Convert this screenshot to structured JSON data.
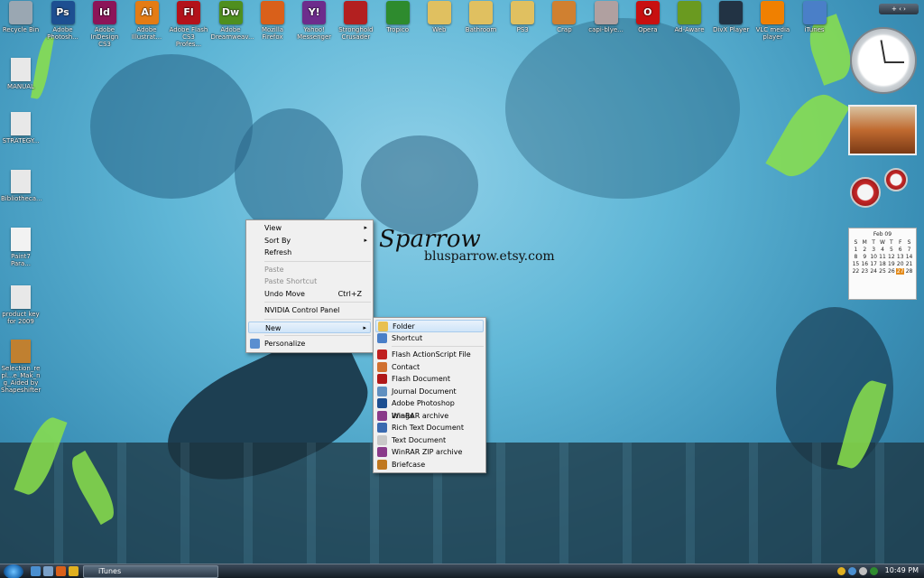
{
  "desktop_icons_top": [
    {
      "label": "Recycle Bin",
      "glyph": "",
      "color": "#9aa7b2",
      "icon": "recycle-bin-icon"
    },
    {
      "label": "Adobe Photosh...",
      "glyph": "Ps",
      "color": "#1d4f91",
      "icon": "photoshop-icon"
    },
    {
      "label": "Adobe InDesign CS3",
      "glyph": "Id",
      "color": "#8c1458",
      "icon": "indesign-icon"
    },
    {
      "label": "Adobe Illustrat...",
      "glyph": "Ai",
      "color": "#e47c14",
      "icon": "illustrator-icon"
    },
    {
      "label": "Adobe Flash CS3 Profes...",
      "glyph": "Fl",
      "color": "#b3121a",
      "icon": "flash-icon"
    },
    {
      "label": "Adobe Dreamweav...",
      "glyph": "Dw",
      "color": "#4f8f1f",
      "icon": "dreamweaver-icon"
    },
    {
      "label": "Mozilla Firefox",
      "glyph": "",
      "color": "#d9601a",
      "icon": "firefox-icon"
    },
    {
      "label": "Yahoo! Messenger",
      "glyph": "Y!",
      "color": "#6d2c8c",
      "icon": "yahoo-messenger-icon"
    },
    {
      "label": "Stronghold Crusader",
      "glyph": "",
      "color": "#b32020",
      "icon": "stronghold-icon"
    },
    {
      "label": "Tropico",
      "glyph": "",
      "color": "#2e8b2e",
      "icon": "tropico-icon"
    },
    {
      "label": "Web",
      "glyph": "",
      "color": "#e0c060",
      "icon": "folder-icon"
    },
    {
      "label": "Bathroom",
      "glyph": "",
      "color": "#e0c060",
      "icon": "folder-icon"
    },
    {
      "label": "PS3",
      "glyph": "",
      "color": "#e0c060",
      "icon": "folder-icon"
    },
    {
      "label": "Crap",
      "glyph": "",
      "color": "#d08030",
      "icon": "folder-icon"
    },
    {
      "label": "capi-blye...",
      "glyph": "",
      "color": "#b0a0a0",
      "icon": "image-file-icon"
    },
    {
      "label": "Opera",
      "glyph": "O",
      "color": "#c81010",
      "icon": "opera-icon"
    },
    {
      "label": "Ad-Aware",
      "glyph": "",
      "color": "#6a9a20",
      "icon": "ad-aware-icon"
    },
    {
      "label": "DivX Player",
      "glyph": "",
      "color": "#223344",
      "icon": "divx-icon"
    },
    {
      "label": "VLC media player",
      "glyph": "",
      "color": "#f08000",
      "icon": "vlc-icon"
    },
    {
      "label": "iTunes",
      "glyph": "",
      "color": "#4a7fc8",
      "icon": "itunes-icon"
    }
  ],
  "desktop_icons_left": [
    {
      "label": "MANUAL",
      "icon": "document-icon"
    },
    {
      "label": "STRATEGY...",
      "icon": "document-icon"
    },
    {
      "label": "Bibliotheca...",
      "icon": "document-icon"
    },
    {
      "label": "Paint7 Para...",
      "icon": "pdf-icon"
    },
    {
      "label": "product key for 2009",
      "icon": "text-file-icon"
    },
    {
      "label": "Selection_re pl...e_Mak_n g_Aided by Shapeshifter",
      "icon": "shortcut-icon"
    }
  ],
  "wallpaper": {
    "title": "Sparrow",
    "url": "blusparrow.etsy.com"
  },
  "context_menu": [
    {
      "label": "View",
      "submenu": true
    },
    {
      "label": "Sort By",
      "submenu": true
    },
    {
      "label": "Refresh"
    },
    {
      "sep": true
    },
    {
      "label": "Paste",
      "disabled": true
    },
    {
      "label": "Paste Shortcut",
      "disabled": true
    },
    {
      "label": "Undo Move",
      "shortcut": "Ctrl+Z"
    },
    {
      "sep": true
    },
    {
      "label": "NVIDIA Control Panel"
    },
    {
      "sep": true
    },
    {
      "label": "New",
      "submenu": true,
      "highlighted": true
    },
    {
      "sep": true
    },
    {
      "label": "Personalize",
      "icon": "personalize-icon"
    }
  ],
  "new_submenu": [
    {
      "label": "Folder",
      "icon": "folder-icon",
      "color": "#e8c050",
      "highlighted": true
    },
    {
      "label": "Shortcut",
      "icon": "shortcut-icon",
      "color": "#4a7fc8"
    },
    {
      "sep": true
    },
    {
      "label": "Flash ActionScript File",
      "icon": "flash-as-icon",
      "color": "#c02020"
    },
    {
      "label": "Contact",
      "icon": "contact-icon",
      "color": "#d07030"
    },
    {
      "label": "Flash Document",
      "icon": "flash-doc-icon",
      "color": "#b01818"
    },
    {
      "label": "Journal Document",
      "icon": "journal-icon",
      "color": "#6090c0"
    },
    {
      "label": "Adobe Photoshop Image",
      "icon": "photoshop-image-icon",
      "color": "#1d4f91"
    },
    {
      "label": "WinRAR archive",
      "icon": "winrar-icon",
      "color": "#8a3a8a"
    },
    {
      "label": "Rich Text Document",
      "icon": "rtf-icon",
      "color": "#3a6ab0"
    },
    {
      "label": "Text Document",
      "icon": "text-doc-icon",
      "color": "#c8c8c8"
    },
    {
      "label": "WinRAR ZIP archive",
      "icon": "winrar-zip-icon",
      "color": "#8a3a8a"
    },
    {
      "label": "Briefcase",
      "icon": "briefcase-icon",
      "color": "#c07820"
    }
  ],
  "calendar": {
    "month": "Feb 09",
    "weekdays": [
      "S",
      "M",
      "T",
      "W",
      "T",
      "F",
      "S"
    ],
    "days": [
      "1",
      "2",
      "3",
      "4",
      "5",
      "6",
      "7",
      "8",
      "9",
      "10",
      "11",
      "12",
      "13",
      "14",
      "15",
      "16",
      "17",
      "18",
      "19",
      "20",
      "21",
      "22",
      "23",
      "24",
      "25",
      "26",
      "27",
      "28"
    ],
    "today": "27"
  },
  "taskbar": {
    "task_label": "iTunes",
    "clock": "10:49 PM"
  }
}
